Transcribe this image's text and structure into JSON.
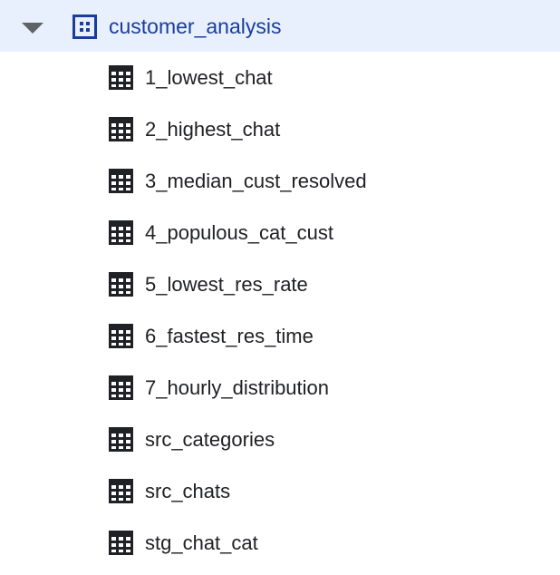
{
  "dataset": {
    "name": "customer_analysis",
    "expand_icon": "caret-down-icon",
    "icon": "dataset-grid-icon",
    "color": "#1a3d9c",
    "highlight": "#e8f0fe"
  },
  "tables": [
    {
      "name": "1_lowest_chat",
      "icon": "table-icon"
    },
    {
      "name": "2_highest_chat",
      "icon": "table-icon"
    },
    {
      "name": "3_median_cust_resolved",
      "icon": "table-icon"
    },
    {
      "name": "4_populous_cat_cust",
      "icon": "table-icon"
    },
    {
      "name": "5_lowest_res_rate",
      "icon": "table-icon"
    },
    {
      "name": "6_fastest_res_time",
      "icon": "table-icon"
    },
    {
      "name": "7_hourly_distribution",
      "icon": "table-icon"
    },
    {
      "name": "src_categories",
      "icon": "table-icon"
    },
    {
      "name": "src_chats",
      "icon": "table-icon"
    },
    {
      "name": "stg_chat_cat",
      "icon": "table-icon"
    }
  ]
}
